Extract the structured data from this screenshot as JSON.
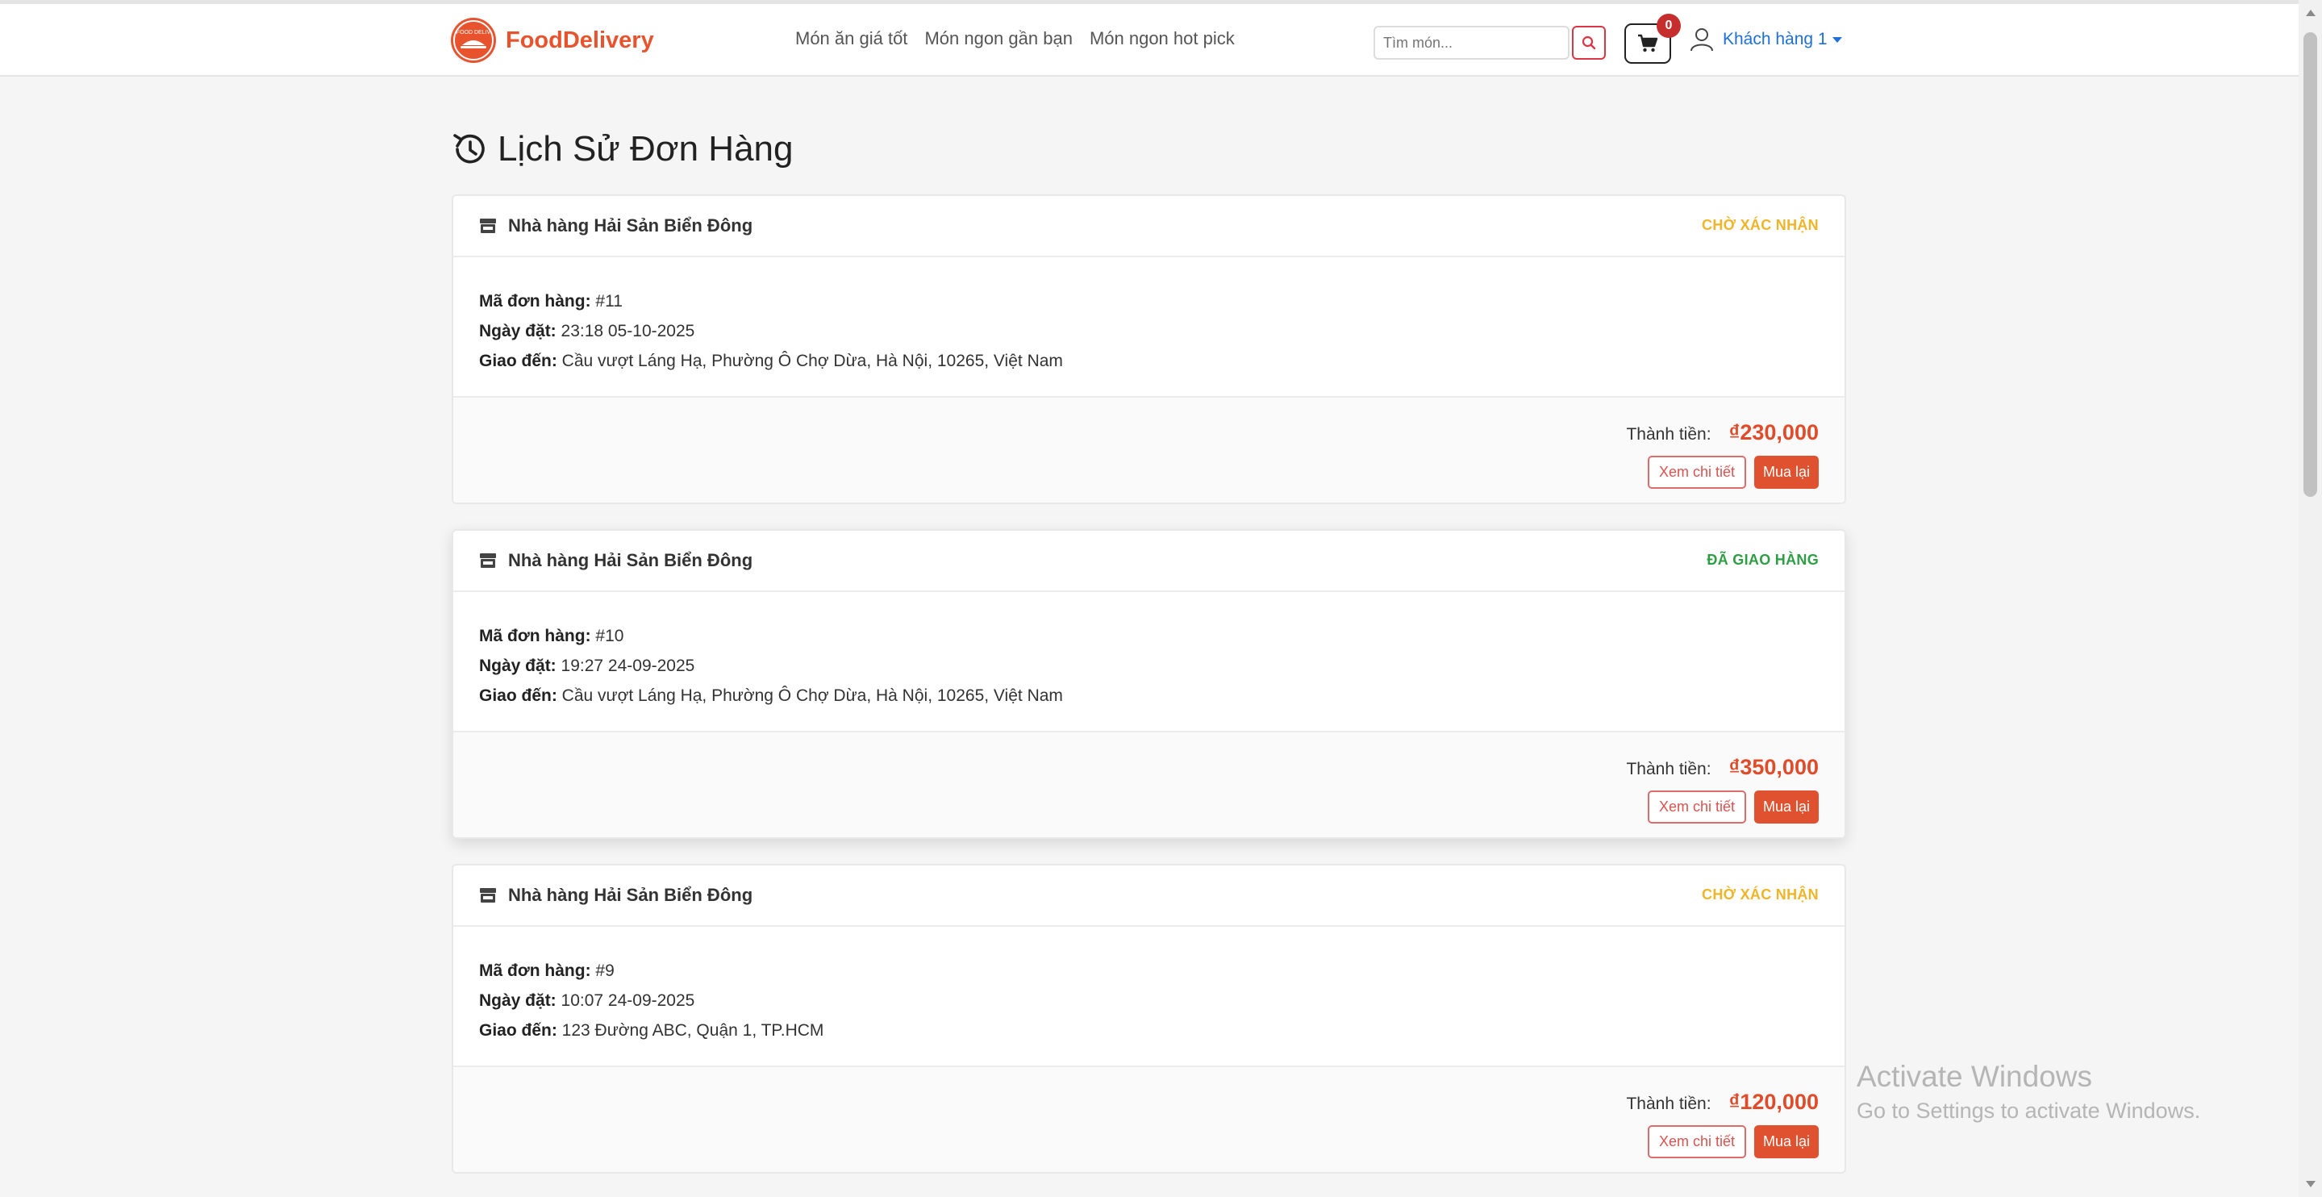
{
  "brand": {
    "name": "FoodDelivery",
    "logo_text": "FOOD DELIV",
    "color": "#e8532e"
  },
  "nav": {
    "links": [
      "Món ăn giá tốt",
      "Món ngon gần bạn",
      "Món ngon hot pick"
    ]
  },
  "search": {
    "placeholder": "Tìm món..."
  },
  "cart": {
    "count": "0"
  },
  "user": {
    "name": "Khách hàng 1"
  },
  "page": {
    "title": "Lịch Sử Đơn Hàng"
  },
  "labels": {
    "order_id": "Mã đơn hàng:",
    "order_date": "Ngày đặt:",
    "deliver_to": "Giao đến:",
    "total": "Thành tiền:",
    "detail_button": "Xem chi tiết",
    "rebuy_button": "Mua lại"
  },
  "orders": [
    {
      "store": "Nhà hàng Hải Sản Biển Đông",
      "status": "CHỜ XÁC NHẬN",
      "status_color": "#f0b429",
      "id": " #11",
      "date": " 23:18 05-10-2025",
      "address": " Cầu vượt Láng Hạ, Phường Ô Chợ Dừa, Hà Nội, 10265, Việt Nam",
      "total": "₫230,000"
    },
    {
      "store": "Nhà hàng Hải Sản Biển Đông",
      "status": "ĐÃ GIAO HÀNG",
      "status_color": "#2e9e44",
      "id": " #10",
      "date": " 19:27 24-09-2025",
      "address": " Cầu vượt Láng Hạ, Phường Ô Chợ Dừa, Hà Nội, 10265, Việt Nam",
      "total": "₫350,000"
    },
    {
      "store": "Nhà hàng Hải Sản Biển Đông",
      "status": "CHỜ XÁC NHẬN",
      "status_color": "#f0b429",
      "id": " #9",
      "date": " 10:07 24-09-2025",
      "address": " 123 Đường ABC, Quận 1, TP.HCM",
      "total": "₫120,000"
    }
  ],
  "watermark": {
    "line1": "Activate Windows",
    "line2": "Go to Settings to activate Windows."
  }
}
